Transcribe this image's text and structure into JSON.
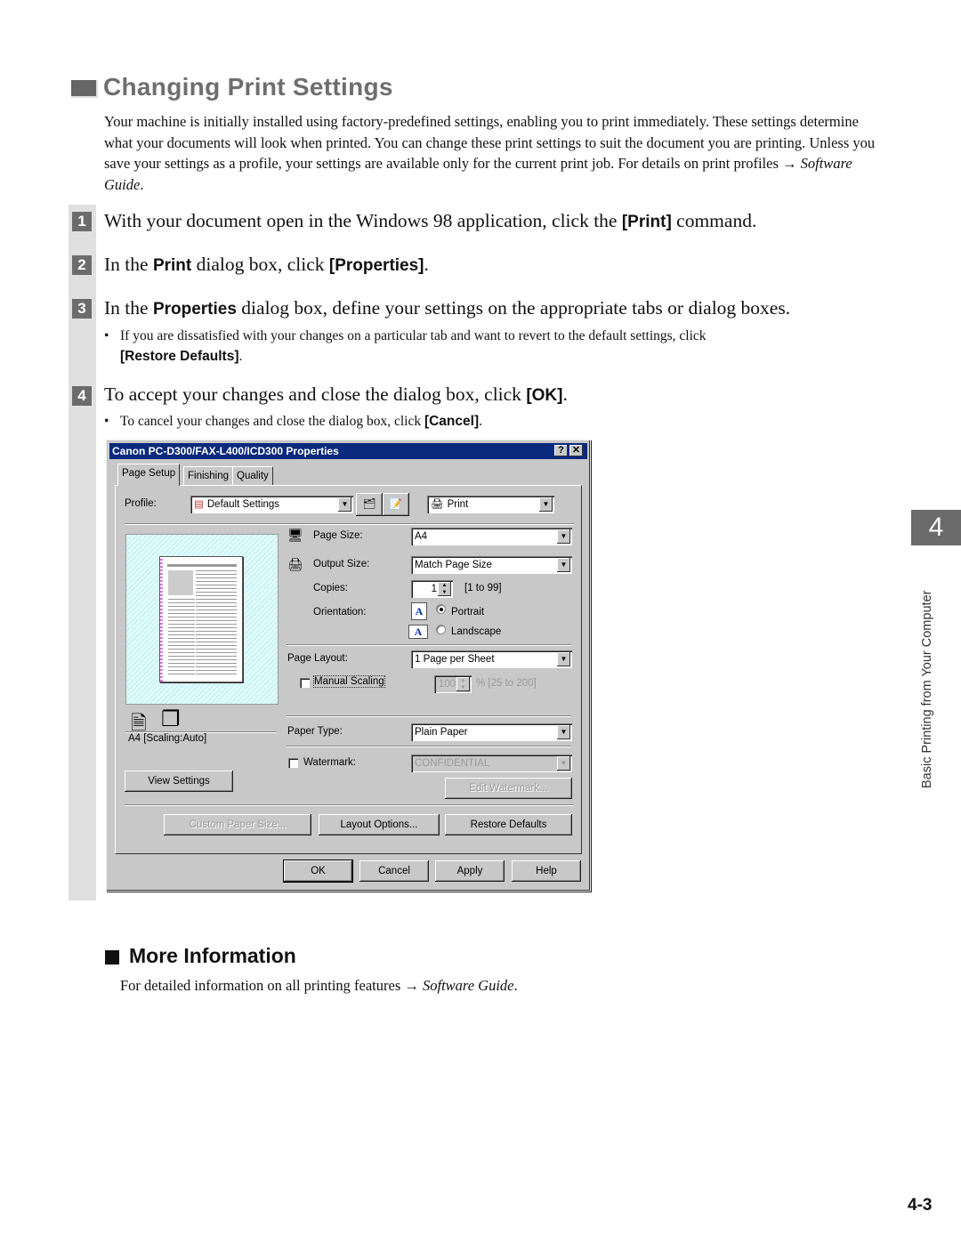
{
  "heading": "Changing Print Settings",
  "intro": {
    "text": "Your machine is initially installed using factory-predefined settings, enabling you to print immediately. These settings determine what your documents will look when printed. You can change these print settings to suit the document you are printing. Unless you save your settings as a profile, your settings are available only for the current print job. For details on print profiles → ",
    "ref": "Software Guide",
    "end": "."
  },
  "steps": [
    {
      "num": "1",
      "pre": "With your document open in the Windows 98 application, click the ",
      "bold": "[Print]",
      "post": " command."
    },
    {
      "num": "2",
      "pre": "In the ",
      "bold": "Print",
      "mid": " dialog box, click ",
      "bold2": "[Properties]",
      "post": "."
    },
    {
      "num": "3",
      "pre": "In the ",
      "bold": "Properties",
      "post": " dialog box, define your settings on the appropriate tabs or dialog boxes."
    },
    {
      "num": "4",
      "pre": "To accept your changes and close the dialog box, click ",
      "bold": "[OK]",
      "post": "."
    }
  ],
  "notes": {
    "step3": {
      "pre": "If you are dissatisfied with your changes on a particular tab and want to revert to the default settings, click",
      "bold": "[Restore Defaults]",
      "post": "."
    },
    "step4": {
      "pre": "To cancel your changes and close the dialog box, click ",
      "bold": "[Cancel]",
      "post": "."
    }
  },
  "dialog": {
    "title": "Canon PC-D300/FAX-L400/ICD300 Properties",
    "help_btn": "?",
    "close_btn": "✕",
    "tabs": [
      "Page Setup",
      "Finishing",
      "Quality"
    ],
    "profile_label": "Profile:",
    "profile_value": "Default Settings",
    "output_value": "Print",
    "preview_caption": "A4 [Scaling:Auto]",
    "view_settings": "View Settings",
    "page_size_label": "Page Size:",
    "page_size_value": "A4",
    "output_size_label": "Output Size:",
    "output_size_value": "Match Page Size",
    "copies_label": "Copies:",
    "copies_value": "1",
    "copies_range": "[1 to 99]",
    "orientation_label": "Orientation:",
    "portrait": "Portrait",
    "landscape": "Landscape",
    "orientation_selected": "Portrait",
    "page_layout_label": "Page Layout:",
    "page_layout_value": "1 Page per Sheet",
    "manual_scaling": "Manual Scaling",
    "scaling_value": "100",
    "scaling_range": "% [25 to 200]",
    "paper_type_label": "Paper Type:",
    "paper_type_value": "Plain Paper",
    "watermark_label": "Watermark:",
    "watermark_value": "CONFIDENTIAL",
    "edit_watermark": "Edit Watermark...",
    "custom_paper": "Custom Paper Size...",
    "layout_options": "Layout Options...",
    "restore_defaults": "Restore Defaults",
    "ok": "OK",
    "cancel": "Cancel",
    "apply": "Apply",
    "help": "Help",
    "orient_icon_glyph": "A"
  },
  "chapter": {
    "number": "4",
    "title": "Basic Printing from Your Computer"
  },
  "more": {
    "title": "More Information",
    "text": "For detailed information on all printing features → ",
    "ref": "Software Guide",
    "end": "."
  },
  "page_number": "4-3"
}
